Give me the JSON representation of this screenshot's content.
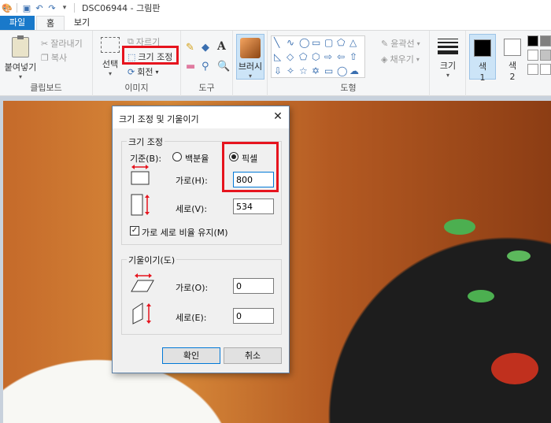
{
  "window": {
    "title": "DSC06944 - 그림판",
    "quick_access": [
      "save-icon",
      "undo-icon",
      "redo-icon",
      "customize-icon"
    ]
  },
  "tabs": {
    "file": "파일",
    "home": "홈",
    "view": "보기"
  },
  "ribbon": {
    "clipboard": {
      "label": "클립보드",
      "paste": "붙여넣기",
      "cut": "잘라내기",
      "copy": "복사"
    },
    "image": {
      "label": "이미지",
      "select": "선택",
      "crop": "자르기",
      "resize": "크기 조정",
      "rotate": "회전"
    },
    "tools": {
      "label": "도구"
    },
    "brush": {
      "label": "브러시"
    },
    "shapes": {
      "label": "도형",
      "outline": "윤곽선",
      "fill": "채우기"
    },
    "size": {
      "label": "크기"
    },
    "color1": {
      "label_top": "색",
      "label_bottom": "1"
    },
    "color2": {
      "label_top": "색",
      "label_bottom": "2"
    }
  },
  "colors": {
    "accent": "#1979ca",
    "highlight": "#e6141e",
    "color1": "#000000",
    "color2": "#ffffff"
  },
  "dialog": {
    "title": "크기 조정 및 기울이기",
    "resize_section": "크기 조정",
    "basis_label": "기준(B):",
    "percent_option": "백분율",
    "pixel_option": "픽셀",
    "selected_basis": "픽셀",
    "horizontal_label": "가로(H):",
    "horizontal_value": "800",
    "vertical_label": "세로(V):",
    "vertical_value": "534",
    "keep_ratio_label": "가로 세로 비율 유지(M)",
    "keep_ratio_checked": true,
    "skew_section": "기울이기(도)",
    "skew_horizontal_label": "가로(O):",
    "skew_horizontal_value": "0",
    "skew_vertical_label": "세로(E):",
    "skew_vertical_value": "0",
    "ok": "확인",
    "cancel": "취소"
  }
}
